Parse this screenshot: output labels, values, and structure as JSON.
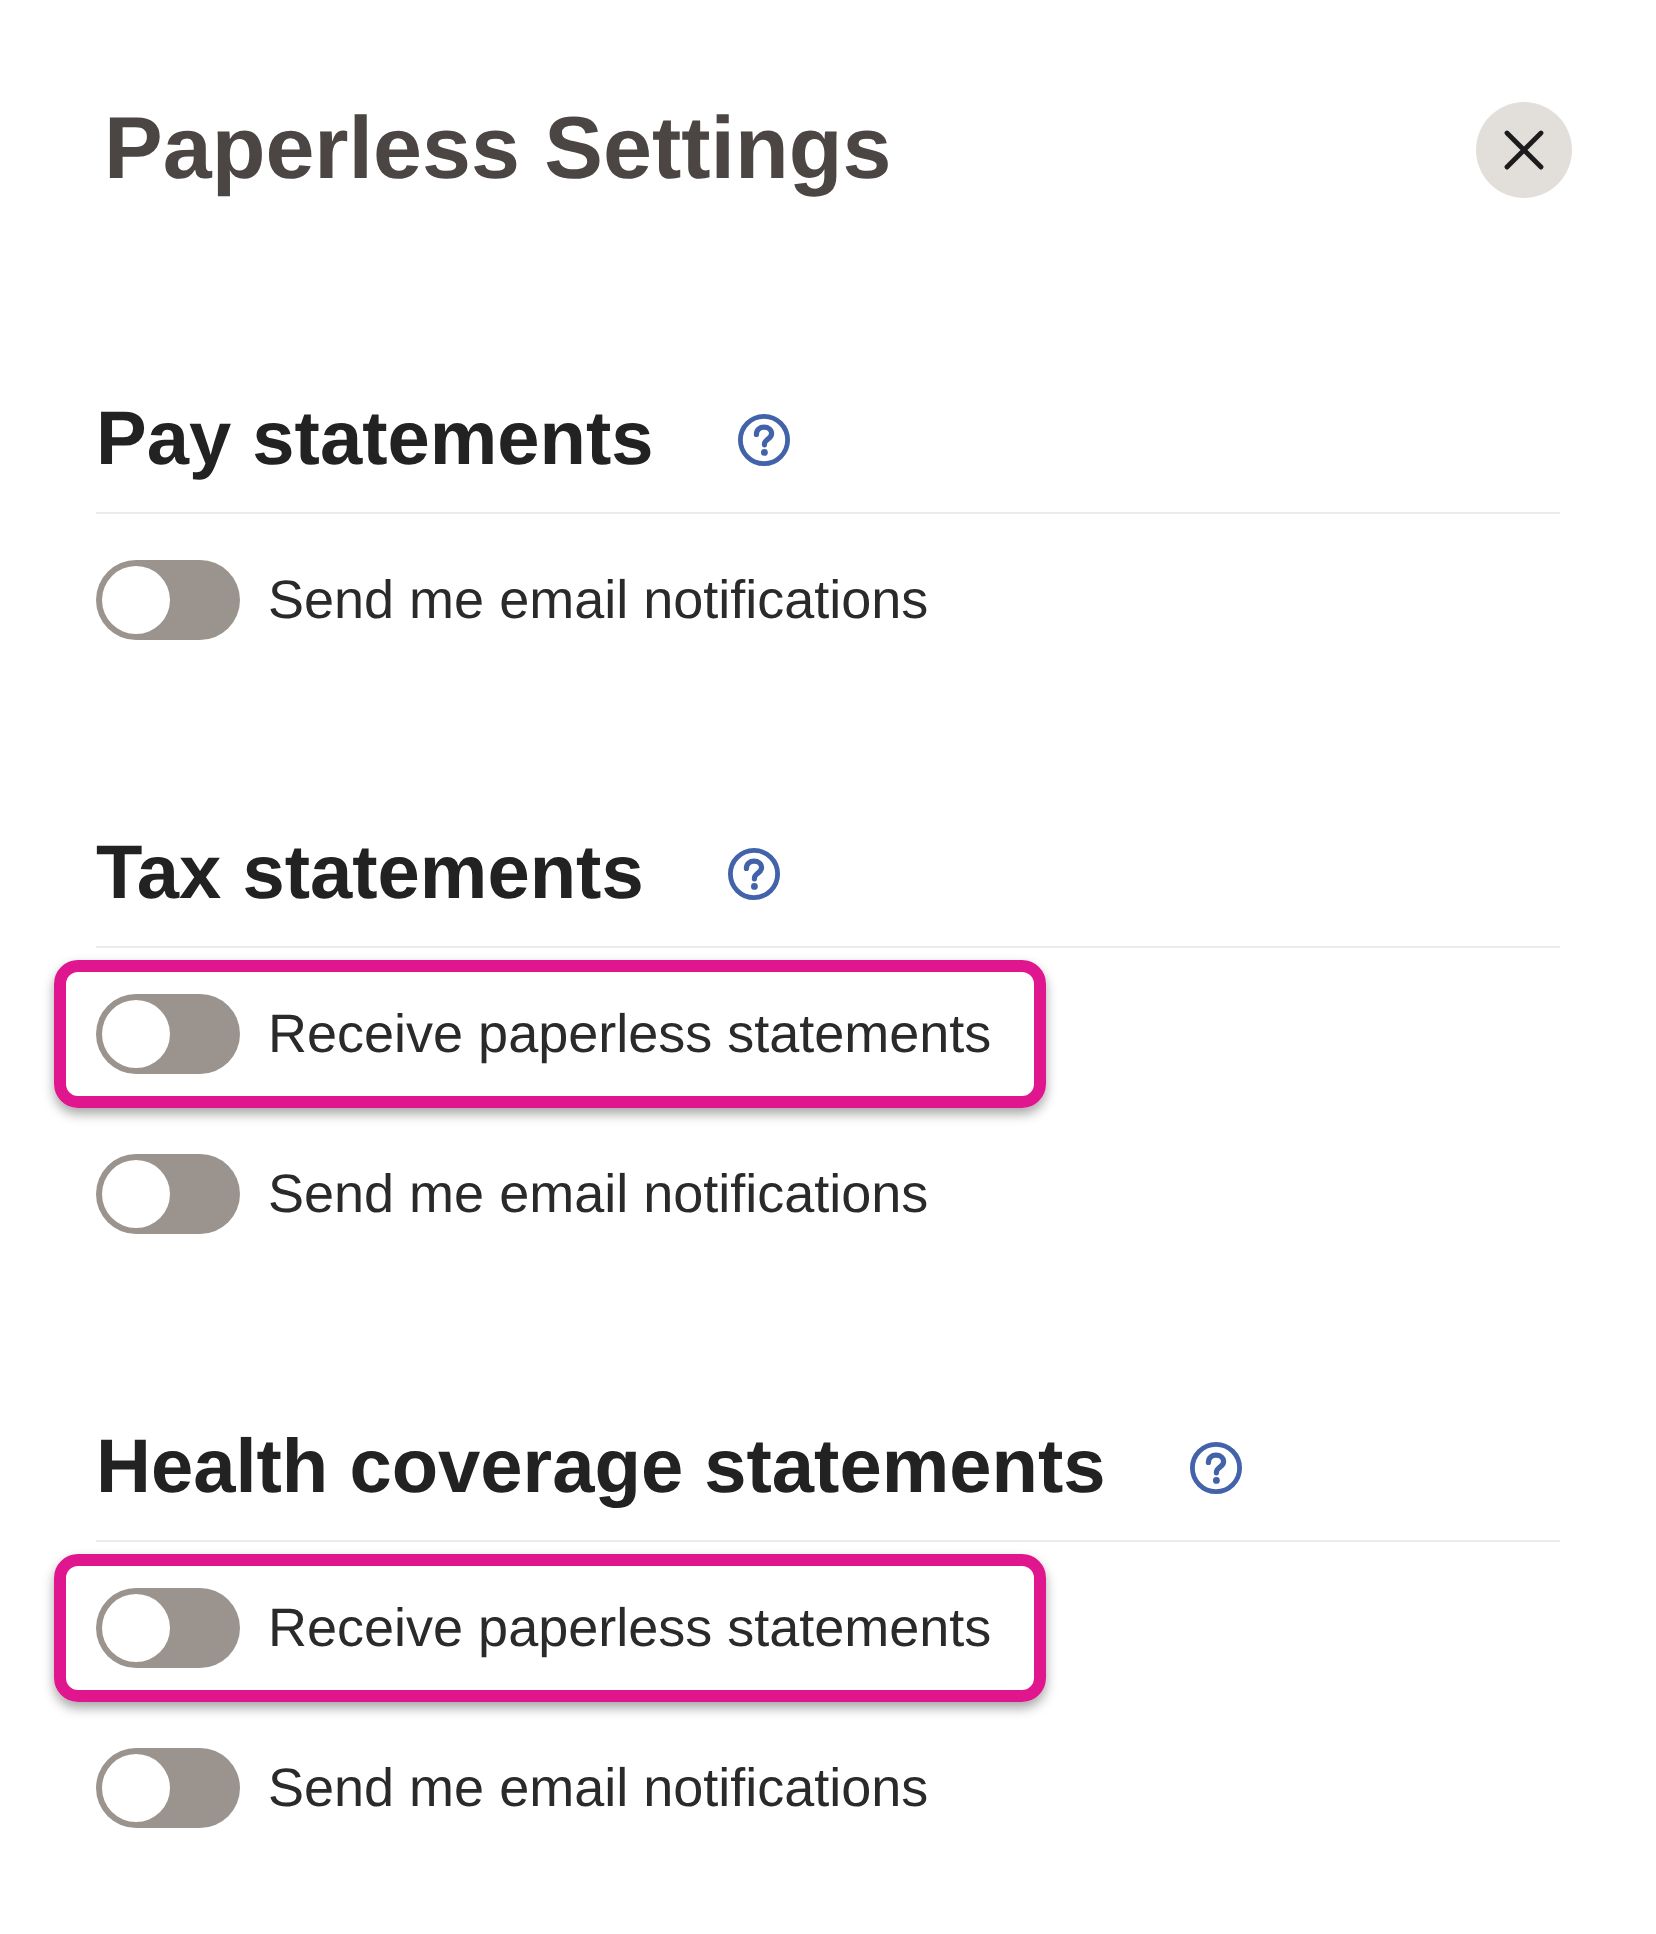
{
  "dialog": {
    "title": "Paperless Settings"
  },
  "sections": [
    {
      "heading": "Pay statements",
      "options": [
        {
          "label": "Send me email notifications",
          "on": false,
          "highlighted": false
        }
      ]
    },
    {
      "heading": "Tax statements",
      "options": [
        {
          "label": "Receive paperless statements",
          "on": false,
          "highlighted": true
        },
        {
          "label": "Send me email notifications",
          "on": false,
          "highlighted": false
        }
      ]
    },
    {
      "heading": "Health coverage statements",
      "options": [
        {
          "label": "Receive paperless statements",
          "on": false,
          "highlighted": true
        },
        {
          "label": "Send me email notifications",
          "on": false,
          "highlighted": false
        }
      ]
    }
  ]
}
